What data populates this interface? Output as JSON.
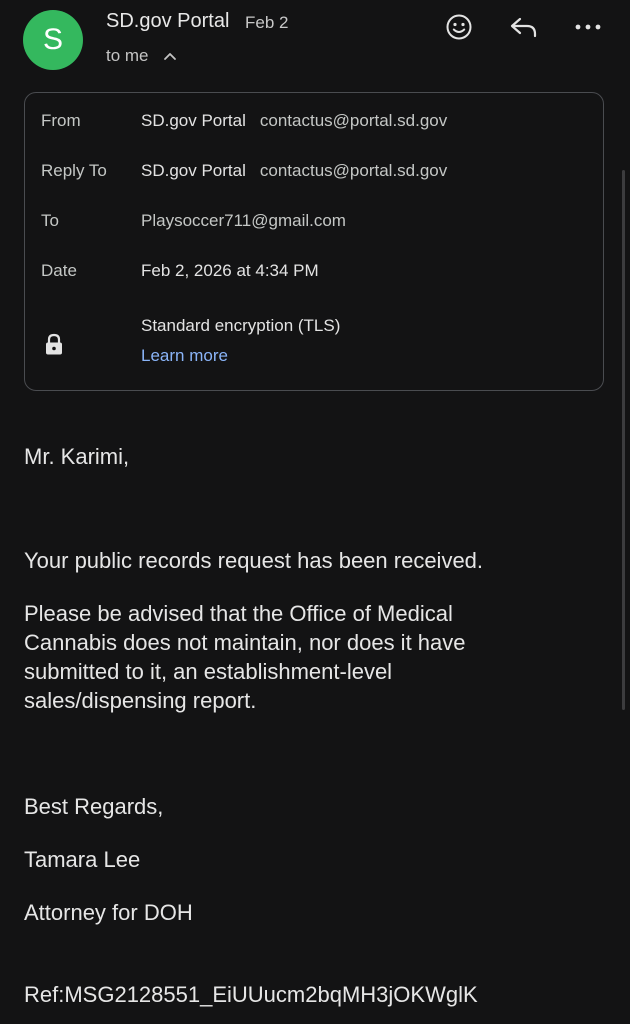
{
  "header": {
    "avatar_letter": "S",
    "sender_name": "SD.gov Portal",
    "date": "Feb 2",
    "recipient_summary": "to me",
    "avatar_color": "#34b85e"
  },
  "actions": {
    "emoji_icon": "emoji-smile-icon",
    "reply_icon": "reply-icon",
    "more_icon": "more-horizontal-icon"
  },
  "details": {
    "from_label": "From",
    "from_name": "SD.gov Portal",
    "from_email": "contactus@portal.sd.gov",
    "reply_to_label": "Reply To",
    "reply_to_name": "SD.gov Portal",
    "reply_to_email": "contactus@portal.sd.gov",
    "to_label": "To",
    "to_value": "Playsoccer711@gmail.com",
    "date_label": "Date",
    "date_value": "Feb 2, 2026 at 4:34 PM",
    "encryption": "Standard encryption (TLS)",
    "learn_more": "Learn more"
  },
  "body": {
    "greeting": "Mr. Karimi,",
    "p1": "Your public records request has been received.",
    "p2_lines": [
      "Please be advised that the Office of Medical",
      "Cannabis does not maintain, nor does it have",
      "submitted to it, an establishment-level",
      "sales/dispensing report."
    ],
    "closing": "Best Regards,",
    "signer": "Tamara Lee",
    "signer_title": "Attorney for DOH",
    "ref": "Ref:MSG2128551_EiUUucm2bqMH3jOKWglK"
  },
  "colors": {
    "background": "#131314",
    "link": "#8ab4f8",
    "border": "#4a4c50"
  }
}
